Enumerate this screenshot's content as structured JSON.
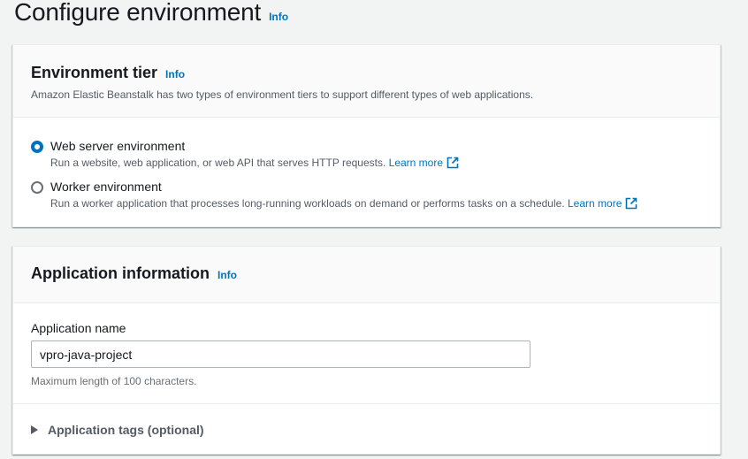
{
  "page": {
    "title": "Configure environment",
    "info_label": "Info"
  },
  "environment_tier": {
    "title": "Environment tier",
    "info_label": "Info",
    "description": "Amazon Elastic Beanstalk has two types of environment tiers to support different types of web applications.",
    "options": [
      {
        "label": "Web server environment",
        "description": "Run a website, web application, or web API that serves HTTP requests.",
        "link_text": "Learn more",
        "selected": true
      },
      {
        "label": "Worker environment",
        "description": "Run a worker application that processes long-running workloads on demand or performs tasks on a schedule.",
        "link_text": "Learn more",
        "selected": false
      }
    ]
  },
  "application_information": {
    "title": "Application information",
    "info_label": "Info",
    "name_label": "Application name",
    "name_value": "vpro-java-project",
    "name_hint": "Maximum length of 100 characters.",
    "tags_expander_label": "Application tags (optional)"
  },
  "colors": {
    "accent": "#0073bb",
    "background": "#f2f3f3",
    "text": "#16191f"
  },
  "icons": {
    "external_link": "external-link-icon",
    "expander": "caret-right-icon"
  }
}
